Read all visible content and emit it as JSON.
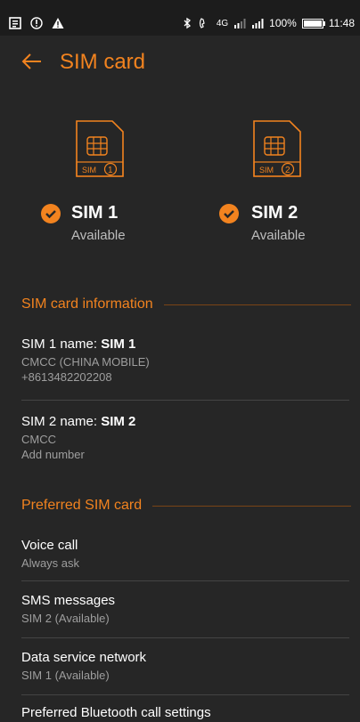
{
  "status_bar": {
    "right_text": "100%",
    "time": "11:48",
    "network": "4G",
    "battery_level": 1.0
  },
  "header": {
    "title": "SIM card"
  },
  "sims": [
    {
      "name": "SIM 1",
      "status": "Available",
      "badge": "SIM",
      "slot": "1"
    },
    {
      "name": "SIM 2",
      "status": "Available",
      "badge": "SIM",
      "slot": "2"
    }
  ],
  "sim_info": {
    "heading": "SIM card information",
    "sim1": {
      "name_label": "SIM 1 name: ",
      "name_value": "SIM 1",
      "carrier": "CMCC (CHINA MOBILE)",
      "number": "+8613482202208"
    },
    "sim2": {
      "name_label": "SIM 2 name: ",
      "name_value": "SIM 2",
      "carrier": "CMCC",
      "number": "Add number"
    }
  },
  "preferred": {
    "heading": "Preferred SIM card",
    "voice": {
      "title": "Voice call",
      "value": "Always ask"
    },
    "sms": {
      "title": "SMS messages",
      "value": "SIM 2 (Available)"
    },
    "data": {
      "title": "Data service network",
      "value": "SIM 1 (Available)"
    },
    "bluetooth": {
      "title": "Preferred Bluetooth call settings"
    }
  },
  "colors": {
    "accent": "#f2831f",
    "background": "#262626"
  }
}
